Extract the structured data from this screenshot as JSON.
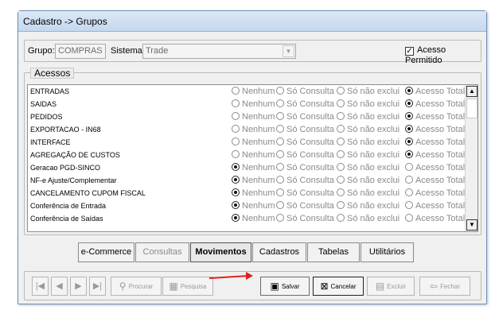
{
  "window": {
    "title": "Cadastro -> Grupos"
  },
  "header": {
    "grupo_label": "Grupo:",
    "grupo_value": "COMPRAS",
    "sistema_label": "Sistema:",
    "sistema_value": "Trade",
    "acesso_label": "Acesso Permitido",
    "acesso_checked": true
  },
  "acessos": {
    "legend": "Acessos",
    "options": [
      "Nenhum",
      "Só Consulta",
      "Só não exclui",
      "Acesso Total"
    ],
    "rows": [
      {
        "name": "ENTRADAS",
        "selected": 3
      },
      {
        "name": "SAIDAS",
        "selected": 3
      },
      {
        "name": "PEDIDOS",
        "selected": 3
      },
      {
        "name": "EXPORTACAO - IN68",
        "selected": 3
      },
      {
        "name": "INTERFACE",
        "selected": 3
      },
      {
        "name": " AGREGAÇÃO DE CUSTOS",
        "selected": 3
      },
      {
        "name": "Geracao PGD-SINCO",
        "selected": 0
      },
      {
        "name": "NF-e Ajuste/Complementar",
        "selected": 0
      },
      {
        "name": "CANCELAMENTO CUPOM FISCAL",
        "selected": 0
      },
      {
        "name": "Conferência de Entrada",
        "selected": 0
      },
      {
        "name": "Conferência de Saídas",
        "selected": 0
      }
    ]
  },
  "tabs": [
    {
      "label": "e-Commerce",
      "state": "normal"
    },
    {
      "label": "Consultas",
      "state": "disabled"
    },
    {
      "label": "Movimentos",
      "state": "active"
    },
    {
      "label": "Cadastros",
      "state": "normal"
    },
    {
      "label": "Tabelas",
      "state": "normal"
    },
    {
      "label": "Utilitários",
      "state": "normal"
    }
  ],
  "toolbar": {
    "procurar": "Procurar",
    "pesquisa": "Pesquisa",
    "salvar": "Salvar",
    "cancelar": "Cancelar",
    "excluir": "Excluir",
    "fechar": "Fechar"
  },
  "colors": {
    "arrow": "#e0201c",
    "titlebar": "#c4d8ee"
  }
}
